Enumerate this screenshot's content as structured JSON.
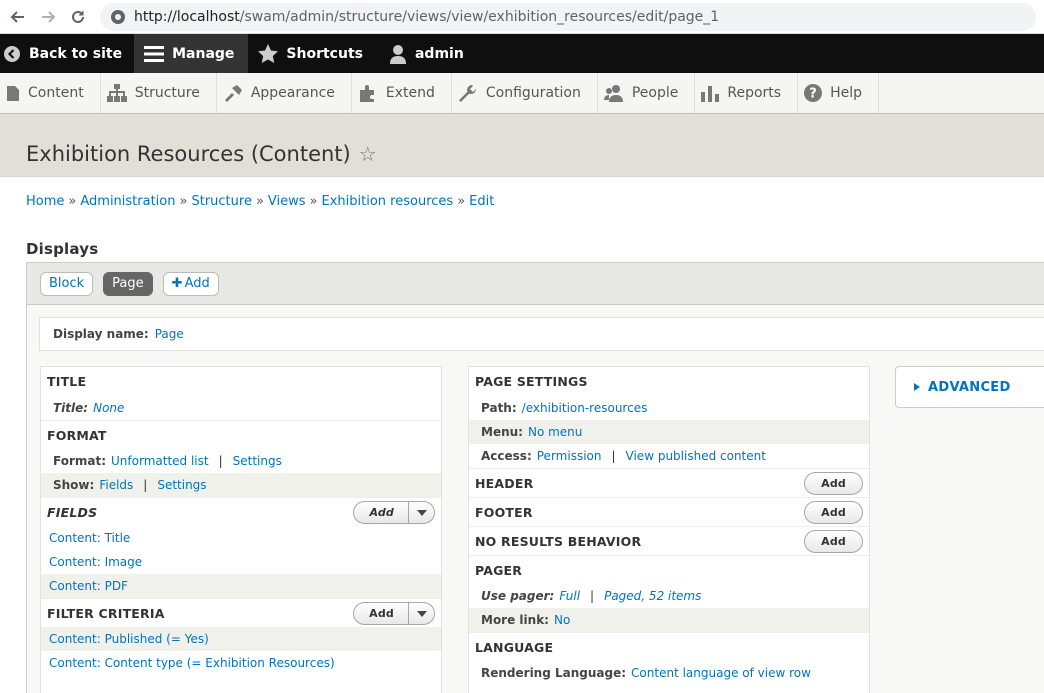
{
  "browser": {
    "url_host": "http://localhost",
    "url_path": "/swam/admin/structure/views/view/exhibition_resources/edit/page_1"
  },
  "toolbar": {
    "back_label": "Back to site",
    "manage_label": "Manage",
    "shortcuts_label": "Shortcuts",
    "user_label": "admin"
  },
  "tray": {
    "items": [
      {
        "label": "Content",
        "icon": "content-icon"
      },
      {
        "label": "Structure",
        "icon": "structure-icon"
      },
      {
        "label": "Appearance",
        "icon": "appearance-icon"
      },
      {
        "label": "Extend",
        "icon": "extend-icon"
      },
      {
        "label": "Configuration",
        "icon": "wrench-icon"
      },
      {
        "label": "People",
        "icon": "people-icon"
      },
      {
        "label": "Reports",
        "icon": "reports-icon"
      },
      {
        "label": "Help",
        "icon": "help-icon"
      }
    ]
  },
  "page": {
    "title": "Exhibition Resources (Content)"
  },
  "breadcrumb": [
    "Home",
    "Administration",
    "Structure",
    "Views",
    "Exhibition resources",
    "Edit"
  ],
  "breadcrumb_sep": "»",
  "displays": {
    "heading": "Displays",
    "tabs": [
      "Block",
      "Page",
      "Add"
    ],
    "display_name_label": "Display name:",
    "display_name_value": "Page"
  },
  "left": {
    "title_hd": "TITLE",
    "title_label": "Title:",
    "title_value": "None",
    "format_hd": "FORMAT",
    "format_label": "Format:",
    "format_value": "Unformatted list",
    "format_settings": "Settings",
    "show_label": "Show:",
    "show_value": "Fields",
    "show_settings": "Settings",
    "fields_hd": "FIELDS",
    "fields": [
      "Content: Title",
      "Content: Image",
      "Content: PDF"
    ],
    "filter_hd": "FILTER CRITERIA",
    "filters": [
      "Content: Published (= Yes)",
      "Content: Content type (= Exhibition Resources)"
    ],
    "add_label": "Add"
  },
  "mid": {
    "page_settings_hd": "PAGE SETTINGS",
    "path_label": "Path:",
    "path_value": "/exhibition-resources",
    "menu_label": "Menu:",
    "menu_value": "No menu",
    "access_label": "Access:",
    "access_value1": "Permission",
    "access_value2": "View published content",
    "header_hd": "HEADER",
    "footer_hd": "FOOTER",
    "noresults_hd": "NO RESULTS BEHAVIOR",
    "pager_hd": "PAGER",
    "use_pager_label": "Use pager:",
    "use_pager_value1": "Full",
    "use_pager_value2": "Paged, 52 items",
    "more_link_label": "More link:",
    "more_link_value": "No",
    "language_hd": "LANGUAGE",
    "render_lang_label": "Rendering Language:",
    "render_lang_value": "Content language of view row",
    "add_label": "Add"
  },
  "advanced": {
    "label": "ADVANCED"
  },
  "pipe": "|"
}
